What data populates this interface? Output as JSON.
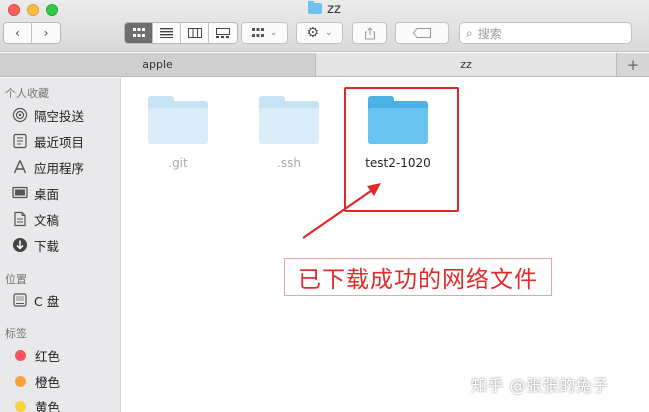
{
  "window": {
    "title": "zz"
  },
  "toolbar": {
    "back_icon": "chevron-left-icon",
    "forward_icon": "chevron-right-icon",
    "view_modes": [
      "icon-view-icon",
      "list-view-icon",
      "column-view-icon",
      "gallery-view-icon"
    ],
    "search_placeholder": "搜索"
  },
  "tabs": [
    {
      "label": "apple"
    },
    {
      "label": "zz"
    }
  ],
  "sidebar": {
    "favorites_header": "个人收藏",
    "favorites": [
      {
        "label": "隔空投送",
        "icon": "airdrop-icon"
      },
      {
        "label": "最近项目",
        "icon": "recents-icon"
      },
      {
        "label": "应用程序",
        "icon": "applications-icon"
      },
      {
        "label": "桌面",
        "icon": "desktop-icon"
      },
      {
        "label": "文稿",
        "icon": "documents-icon"
      },
      {
        "label": "下载",
        "icon": "downloads-icon"
      }
    ],
    "locations_header": "位置",
    "locations": [
      {
        "label": "C 盘",
        "icon": "disk-icon"
      }
    ],
    "tags_header": "标签",
    "tags": [
      {
        "label": "红色",
        "color": "#f4545a"
      },
      {
        "label": "橙色",
        "color": "#f8a03c"
      },
      {
        "label": "黄色",
        "color": "#f7d33d"
      }
    ]
  },
  "files": [
    {
      "name": ".git",
      "hidden": true
    },
    {
      "name": ".ssh",
      "hidden": true
    },
    {
      "name": "test2-1020",
      "hidden": false
    }
  ],
  "annotation": {
    "text": "已下载成功的网络文件",
    "color": "#e12a2a"
  },
  "watermark": "知乎 @张张的兔子"
}
